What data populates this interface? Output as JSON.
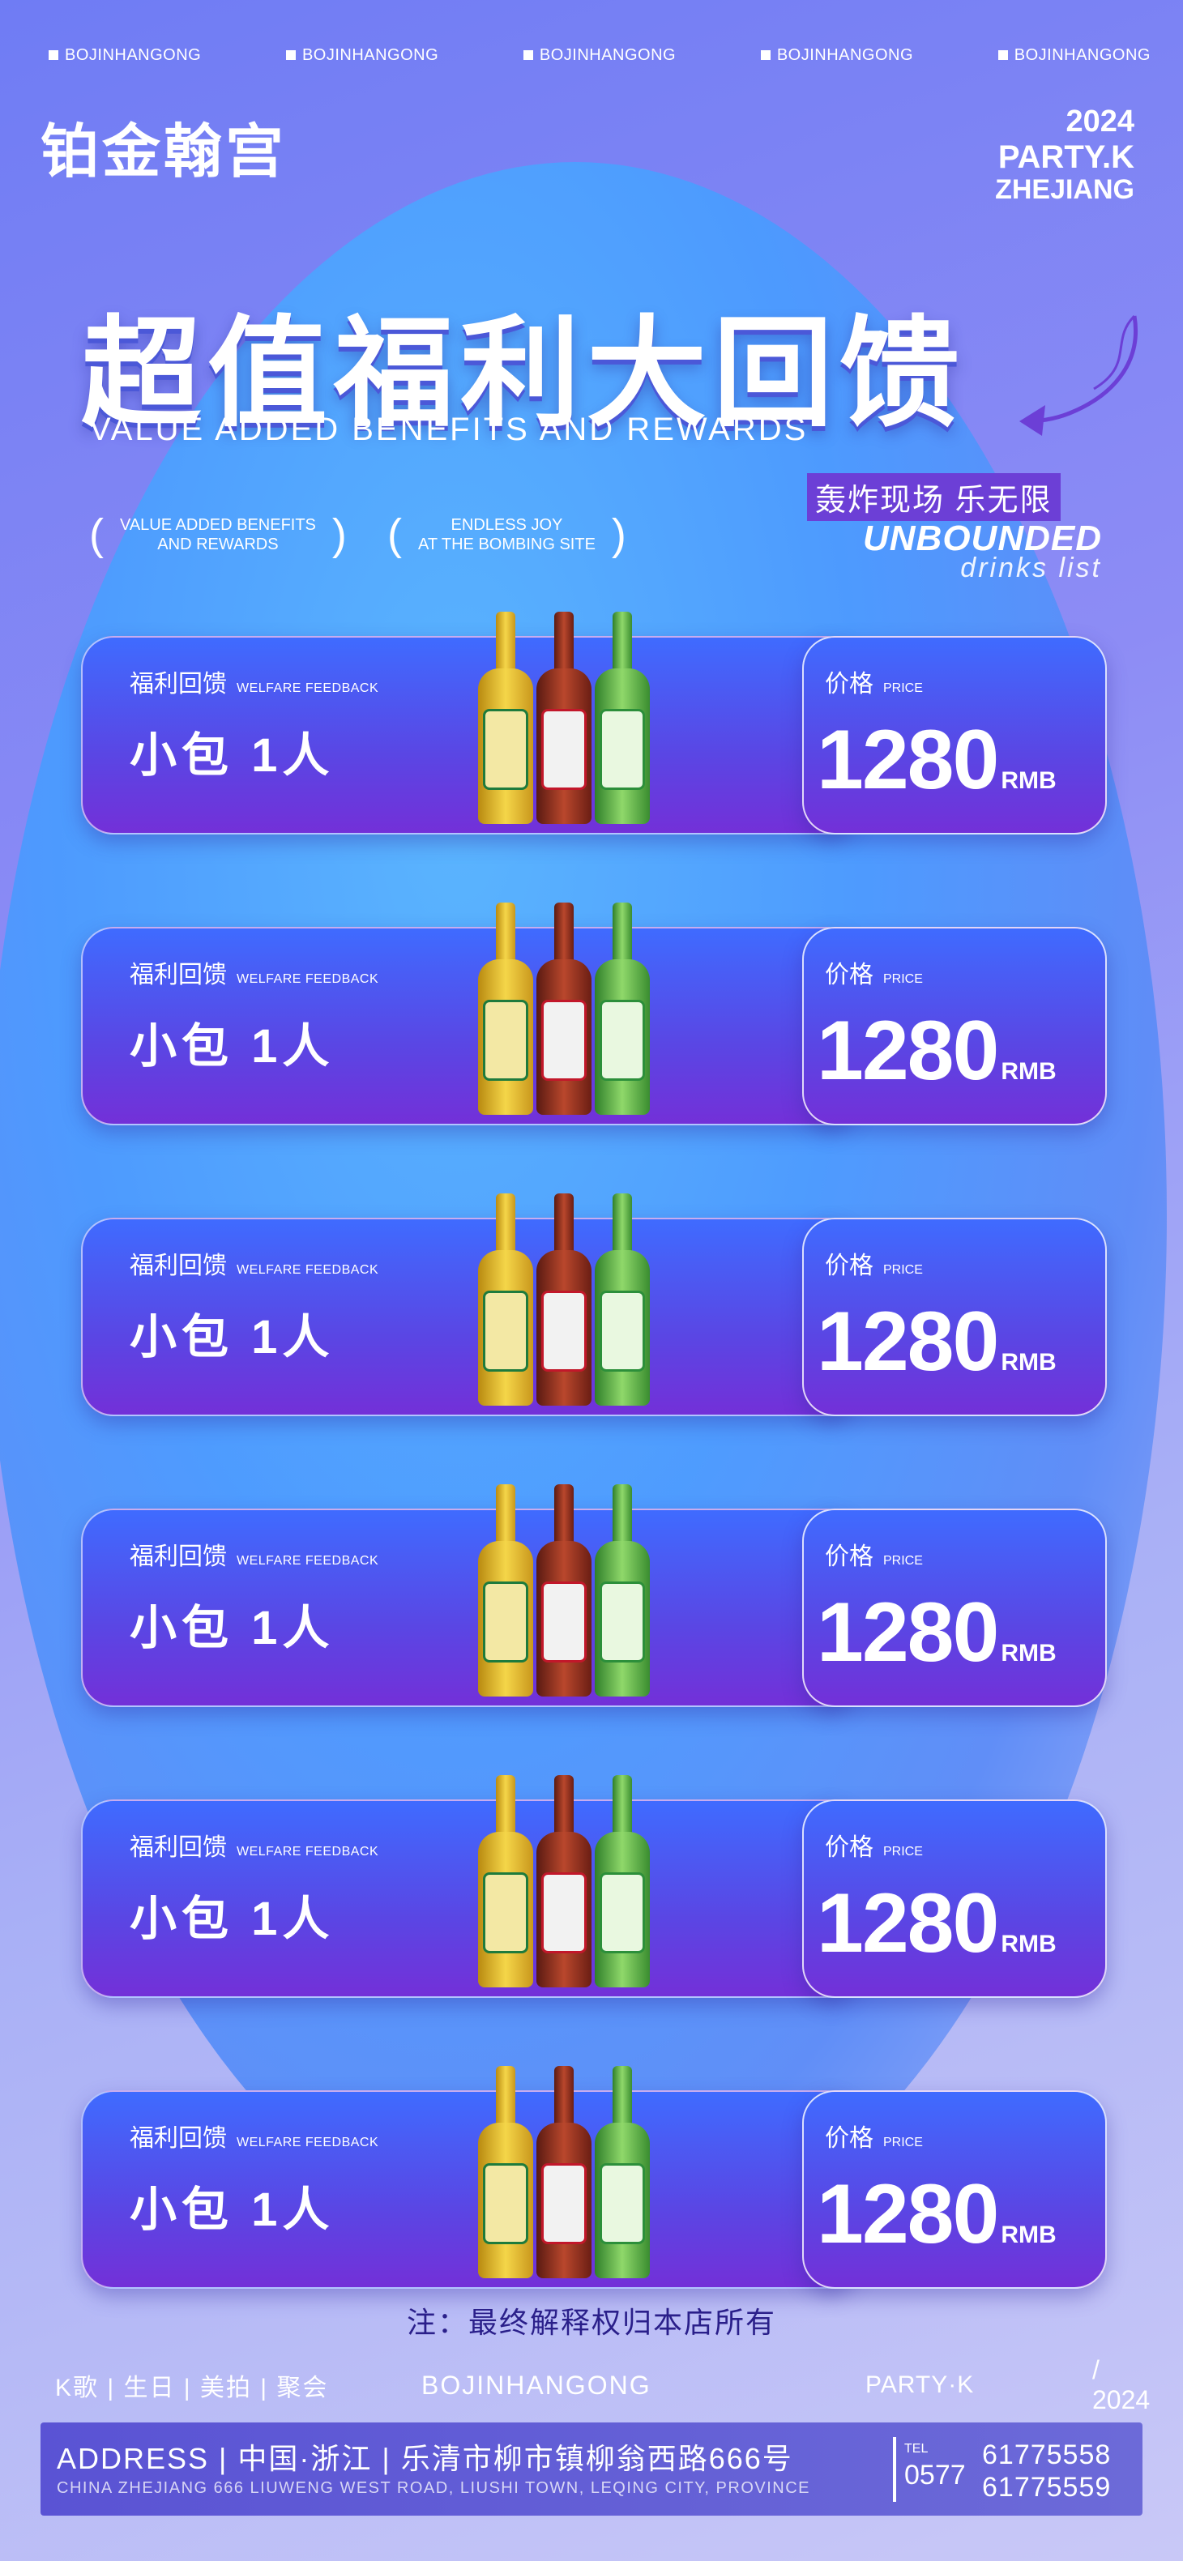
{
  "top_tags": [
    "BOJINHANGONG",
    "BOJINHANGONG",
    "BOJINHANGONG",
    "BOJINHANGONG",
    "BOJINHANGONG"
  ],
  "brand": "铂金翰宫",
  "party": {
    "year": "2024",
    "name": "PARTY.K",
    "region": "ZHEJIANG"
  },
  "headline": "超值福利大回馈",
  "subhead": "VALUE ADDED BENEFITS AND REWARDS",
  "bracket1": {
    "line1": "VALUE ADDED BENEFITS",
    "line2": "AND REWARDS"
  },
  "bracket2": {
    "line1": "ENDLESS JOY",
    "line2": "AT THE BOMBING SITE"
  },
  "slogan": "轰炸现场  乐无限",
  "unbounded": "UNBOUNDED",
  "drinks_list": "drinks list",
  "cards": [
    {
      "label": "福利回馈",
      "label_en": "WELFARE FEEDBACK",
      "item": "小包  1人",
      "price_label": "价格",
      "price_label_en": "PRICE",
      "price": "1280",
      "unit": "RMB"
    },
    {
      "label": "福利回馈",
      "label_en": "WELFARE FEEDBACK",
      "item": "小包  1人",
      "price_label": "价格",
      "price_label_en": "PRICE",
      "price": "1280",
      "unit": "RMB"
    },
    {
      "label": "福利回馈",
      "label_en": "WELFARE FEEDBACK",
      "item": "小包  1人",
      "price_label": "价格",
      "price_label_en": "PRICE",
      "price": "1280",
      "unit": "RMB"
    },
    {
      "label": "福利回馈",
      "label_en": "WELFARE FEEDBACK",
      "item": "小包  1人",
      "price_label": "价格",
      "price_label_en": "PRICE",
      "price": "1280",
      "unit": "RMB"
    },
    {
      "label": "福利回馈",
      "label_en": "WELFARE FEEDBACK",
      "item": "小包  1人",
      "price_label": "价格",
      "price_label_en": "PRICE",
      "price": "1280",
      "unit": "RMB"
    },
    {
      "label": "福利回馈",
      "label_en": "WELFARE FEEDBACK",
      "item": "小包  1人",
      "price_label": "价格",
      "price_label_en": "PRICE",
      "price": "1280",
      "unit": "RMB"
    }
  ],
  "note": "注：最终解释权归本店所有",
  "footer_tags": "K歌 | 生日 | 美拍 | 聚会",
  "footer_brand": "BOJINHANGONG",
  "footer_party": "PARTY·K",
  "footer_year": "/    2024",
  "address": {
    "line1": "ADDRESS  | 中国·浙江 |  乐清市柳市镇柳翁西路666号",
    "line2": "CHINA ZHEJIANG 666 LIUWENG WEST ROAD, LIUSHI TOWN, LEQING CITY,  PROVINCE",
    "tel_label": "TEL",
    "area_code": "0577",
    "phone1": "61775558",
    "phone2": "61775559"
  },
  "colors": {
    "accent": "#6c3fd6",
    "card_top": "#3f6bff",
    "card_bottom": "#7330d8",
    "note_text": "#2a1f8a"
  }
}
